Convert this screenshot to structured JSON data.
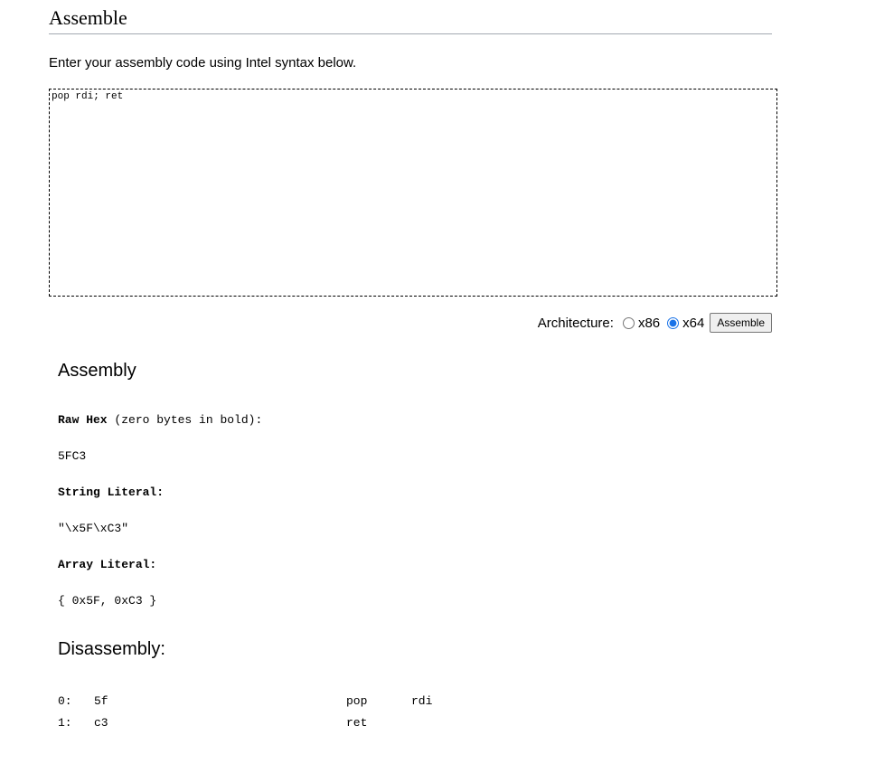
{
  "page": {
    "title": "Assemble",
    "intro": "Enter your assembly code using Intel syntax below."
  },
  "editor": {
    "code": "pop rdi; ret"
  },
  "architecture": {
    "label": "Architecture:",
    "options": [
      {
        "label": "x86",
        "selected": false
      },
      {
        "label": "x64",
        "selected": true
      }
    ],
    "button_label": "Assemble"
  },
  "assembly": {
    "heading": "Assembly",
    "raw_hex_label": "Raw Hex",
    "raw_hex_note": "(zero bytes in bold):",
    "raw_hex_value": "5FC3",
    "string_literal_label": "String Literal:",
    "string_literal_value": "\"\\x5F\\xC3\"",
    "array_literal_label": "Array Literal:",
    "array_literal_value": "{ 0x5F, 0xC3 }"
  },
  "disassembly": {
    "heading": "Disassembly:",
    "rows": [
      {
        "offset": "0:",
        "hex": "5f",
        "mnemonic": "pop",
        "operands": "rdi"
      },
      {
        "offset": "1:",
        "hex": "c3",
        "mnemonic": "ret",
        "operands": ""
      }
    ]
  }
}
